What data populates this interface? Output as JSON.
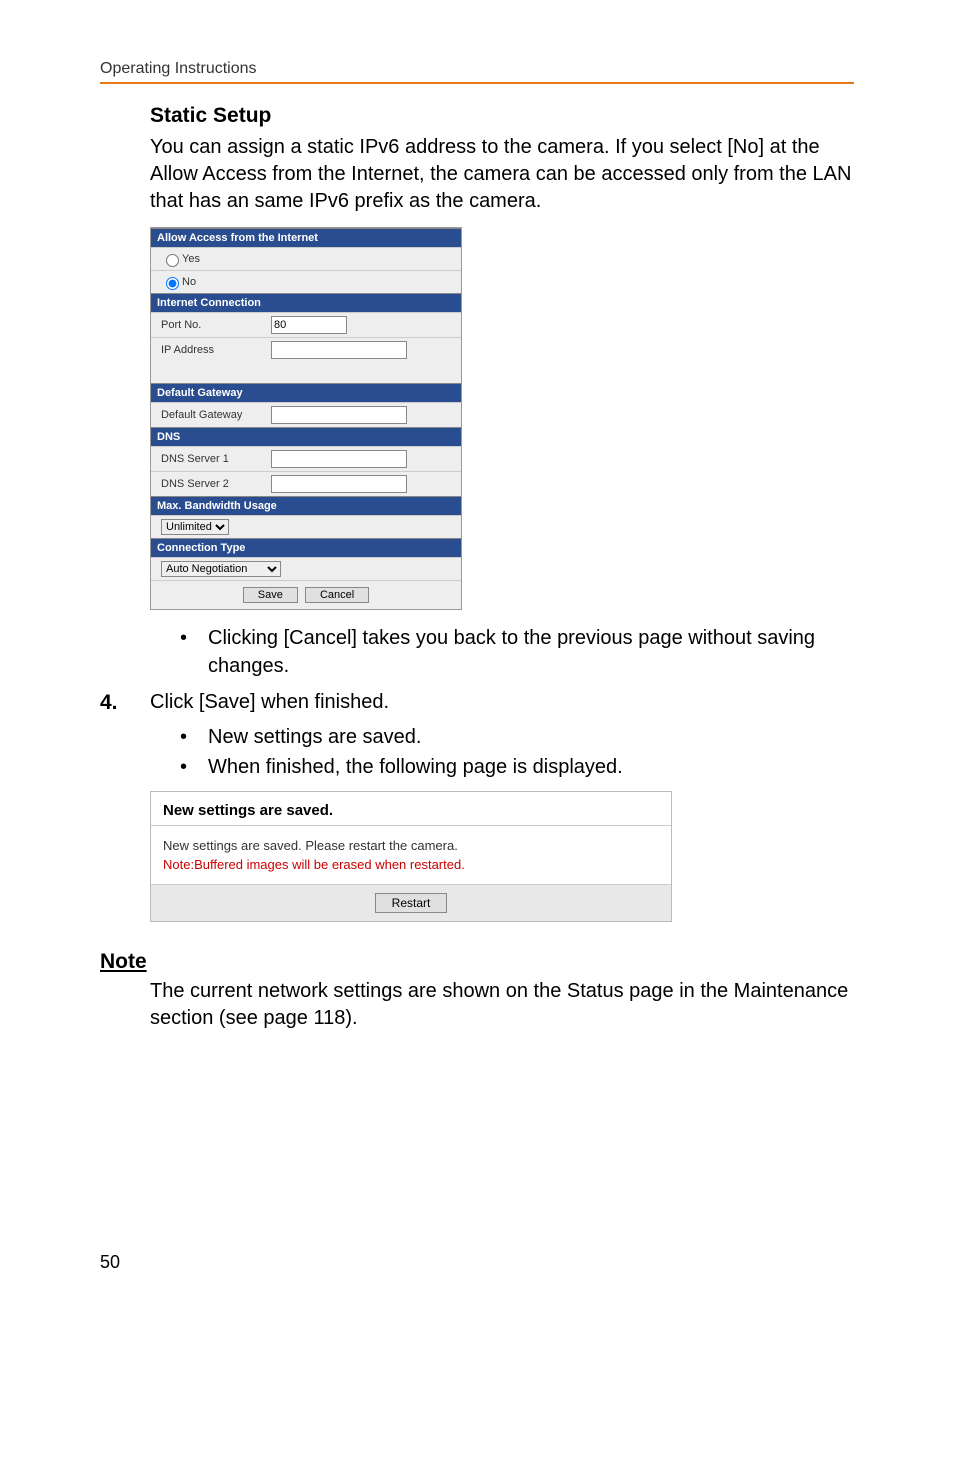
{
  "header": "Operating Instructions",
  "section_title": "Static Setup",
  "intro": "You can assign a static IPv6 address to the camera. If you select [No] at the Allow Access from the Internet, the camera can be accessed only from the LAN that has an same IPv6 prefix as the camera.",
  "form": {
    "allow_access_header": "Allow Access from the Internet",
    "yes": "Yes",
    "no": "No",
    "internet_conn_header": "Internet Connection",
    "port_no_label": "Port No.",
    "port_no_value": "80",
    "ip_address_label": "IP Address",
    "default_gateway_header": "Default Gateway",
    "default_gateway_label": "Default Gateway",
    "dns_header": "DNS",
    "dns1_label": "DNS Server 1",
    "dns2_label": "DNS Server 2",
    "bandwidth_header": "Max. Bandwidth Usage",
    "bandwidth_value": "Unlimited",
    "conn_type_header": "Connection Type",
    "conn_type_value": "Auto Negotiation",
    "save_btn": "Save",
    "cancel_btn": "Cancel"
  },
  "cancel_note": "Clicking [Cancel] takes you back to the previous page without saving changes.",
  "step4_num": "4.",
  "step4_text": "Click [Save] when finished.",
  "step4_b1": "New settings are saved.",
  "step4_b2": "When finished, the following page is displayed.",
  "saved": {
    "title": "New settings are saved.",
    "line1": "New settings are saved. Please restart the camera.",
    "line2": "Note:Buffered images will be erased when restarted.",
    "restart_btn": "Restart"
  },
  "note_heading": "Note",
  "note_text": "The current network settings are shown on the Status page in the Maintenance section (see page 118).",
  "page_number": "50"
}
